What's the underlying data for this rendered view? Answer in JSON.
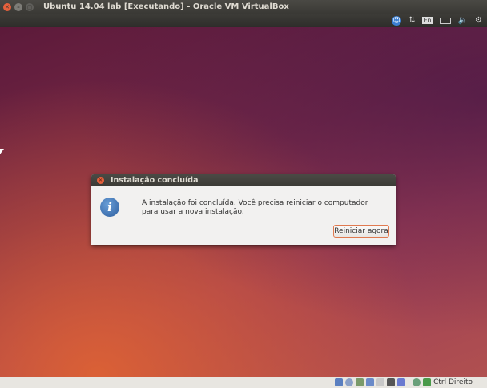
{
  "host_window": {
    "title": "Ubuntu 14.04 lab [Executando] - Oracle VM VirtualBox"
  },
  "guest_panel": {
    "indicators": [
      "accessibility-icon",
      "network-icon",
      "keyboard-layout",
      "battery-icon",
      "volume-icon",
      "gear-icon"
    ],
    "keyboard_layout": "En"
  },
  "dialog": {
    "title": "Instalação concluída",
    "message": "A instalação foi concluída. Você precisa reiniciar o computador para usar a nova instalação.",
    "button": "Reiniciar agora",
    "icon": "info-icon"
  },
  "statusbar": {
    "host_key": "Ctrl Direito"
  },
  "colors": {
    "accent": "#e07a50",
    "close": "#e5603c",
    "info": "#2d5d9e"
  }
}
